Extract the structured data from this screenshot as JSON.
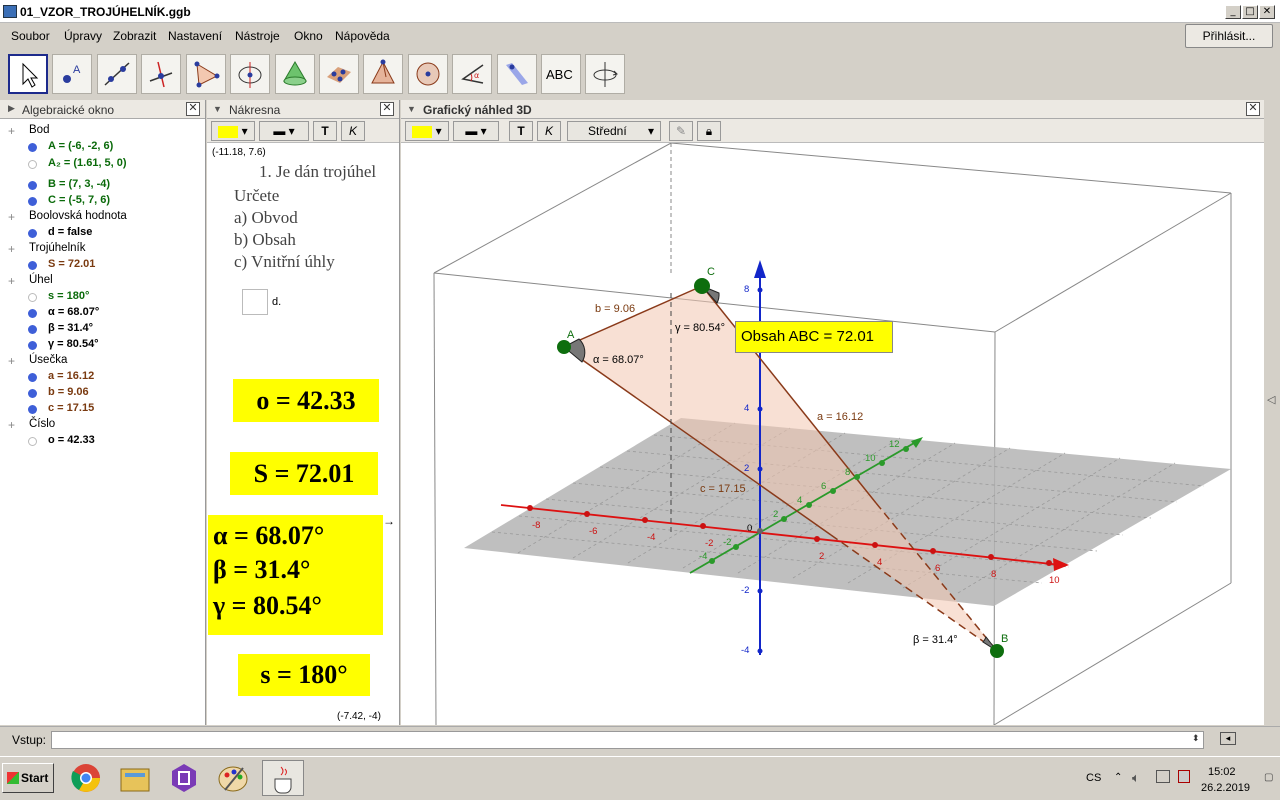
{
  "window": {
    "title": "01_VZOR_TROJÚHELNÍK.ggb"
  },
  "menu": [
    "Soubor",
    "Úpravy",
    "Zobrazit",
    "Nastavení",
    "Nástroje",
    "Okno",
    "Nápověda"
  ],
  "signin": "Přihlásit...",
  "toolbar": {
    "undo": "↶",
    "redo": "↷",
    "help": "?",
    "settings": "⚙",
    "text_tool": "ABC"
  },
  "algebra": {
    "title": "Algebraické okno",
    "rows": [
      {
        "kind": "cat",
        "text": "Bod"
      },
      {
        "kind": "item",
        "text": "A = (-6, -2, 6)",
        "color": "#0a6a0a",
        "on": true
      },
      {
        "kind": "item",
        "text": "A₂ = (1.61, 5, 0)",
        "color": "#0a6a0a",
        "on": false
      },
      {
        "kind": "item",
        "text": "B = (7, 3, -4)",
        "color": "#0a6a0a",
        "on": true
      },
      {
        "kind": "item",
        "text": "C = (-5, 7, 6)",
        "color": "#0a6a0a",
        "on": true
      },
      {
        "kind": "cat",
        "text": "Boolovská hodnota"
      },
      {
        "kind": "item",
        "text": "d = false",
        "color": "#000000",
        "on": true
      },
      {
        "kind": "cat",
        "text": "Trojúhelník"
      },
      {
        "kind": "item",
        "text": "S = 72.01",
        "color": "#7a3a10",
        "on": true
      },
      {
        "kind": "cat",
        "text": "Úhel"
      },
      {
        "kind": "item",
        "text": "s = 180°",
        "color": "#0a6a0a",
        "on": false
      },
      {
        "kind": "item",
        "text": "α = 68.07°",
        "color": "#000000",
        "on": true
      },
      {
        "kind": "item",
        "text": "β = 31.4°",
        "color": "#000000",
        "on": true
      },
      {
        "kind": "item",
        "text": "γ = 80.54°",
        "color": "#000000",
        "on": true
      },
      {
        "kind": "cat",
        "text": "Úsečka"
      },
      {
        "kind": "item",
        "text": "a = 16.12",
        "color": "#7a3a10",
        "on": true
      },
      {
        "kind": "item",
        "text": "b = 9.06",
        "color": "#7a3a10",
        "on": true
      },
      {
        "kind": "item",
        "text": "c = 17.15",
        "color": "#7a3a10",
        "on": true
      },
      {
        "kind": "cat",
        "text": "Číslo"
      },
      {
        "kind": "item",
        "text": "o = 42.33",
        "color": "#000000",
        "on": false
      }
    ]
  },
  "graphics": {
    "title": "Nákresna",
    "corner_top": "(-11.18, 7.6)",
    "corner_bottom": "(-7.42, -4)",
    "task": [
      "1. Je dán trojúhel",
      "Určete",
      "a) Obvod",
      "b) Obsah",
      "c) Vnitřní úhly"
    ],
    "checkbox_label": "d.",
    "box_o": "o = 42.33",
    "box_S": "S = 72.01",
    "box_alpha": "α = 68.07°",
    "box_beta": "β = 31.4°",
    "box_gamma": "γ = 80.54°",
    "box_s": "s = 180°"
  },
  "view3d": {
    "title": "Grafický náhled 3D",
    "line_style": "Střední",
    "tooltip": "Obsah  ABC = 72.01",
    "labels": {
      "A": "A",
      "B": "B",
      "C": "C",
      "a": "a = 16.12",
      "b": "b = 9.06",
      "c": "c = 17.15",
      "alpha": "α = 68.07°",
      "beta": "β = 31.4°",
      "gamma": "γ = 80.54°"
    },
    "zticks": [
      "8",
      "6",
      "4",
      "2",
      "-2",
      "-4"
    ],
    "xticks": [
      "-8",
      "-6",
      "-4",
      "-2",
      "2",
      "4",
      "6",
      "8",
      "10"
    ],
    "yticks": [
      "-4",
      "-2",
      "2",
      "4",
      "6",
      "8",
      "10",
      "12"
    ],
    "origin": "0"
  },
  "input": {
    "label": "Vstup:"
  },
  "taskbar": {
    "start": "Start",
    "lang": "CS",
    "time": "15:02",
    "date": "26.2.2019"
  }
}
